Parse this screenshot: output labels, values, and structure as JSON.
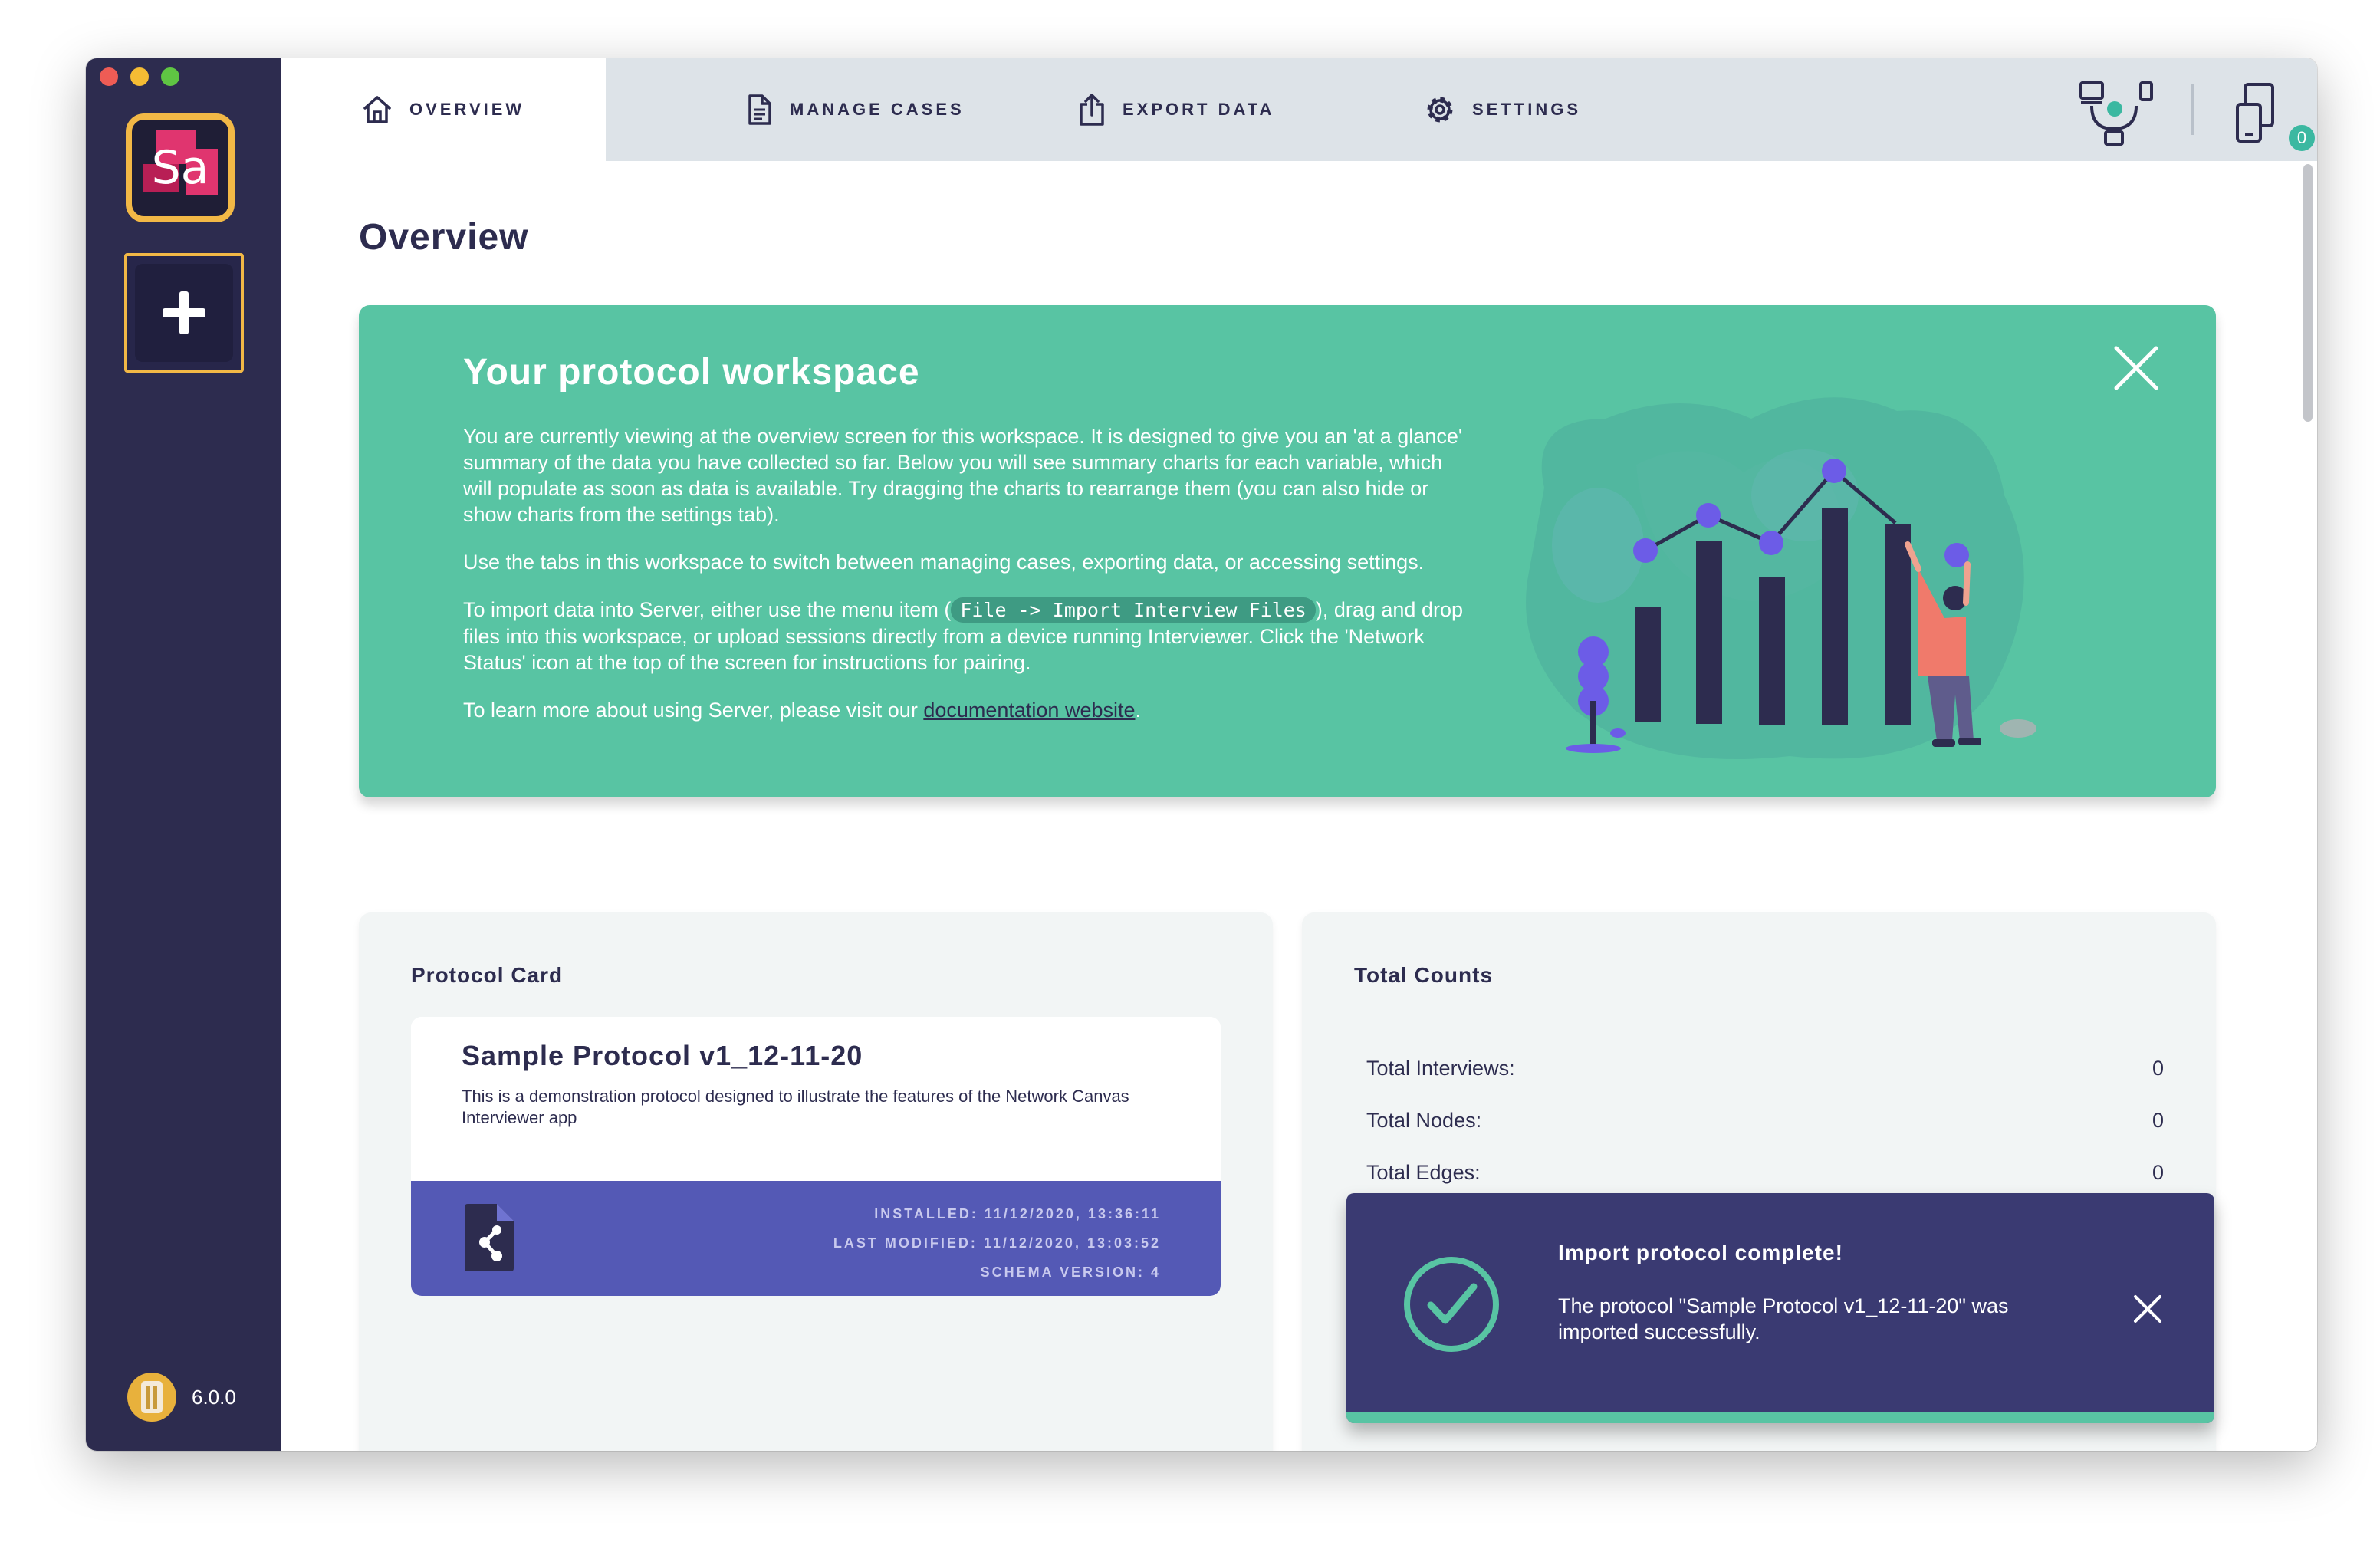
{
  "window": {
    "workspace_abbrev": "Sa",
    "version": "6.0.0"
  },
  "tabs": {
    "overview": "OVERVIEW",
    "manage_cases": "MANAGE CASES",
    "export_data": "EXPORT DATA",
    "settings": "SETTINGS"
  },
  "status": {
    "device_count": "0"
  },
  "page": {
    "title": "Overview"
  },
  "banner": {
    "title": "Your protocol workspace",
    "p1": "You are currently viewing at the overview screen for this workspace. It is designed to give you an 'at a glance' summary of the data you have collected so far. Below you will see summary charts for each variable, which will populate as soon as data is available. Try dragging the charts to rearrange them (you can also hide or show charts from the settings tab).",
    "p2": "Use the tabs in this workspace to switch between managing cases, exporting data, or accessing settings.",
    "p3_before": "To import data into Server, either use the menu item (",
    "p3_code": "File -> Import Interview Files",
    "p3_after": "), drag and drop files into this workspace, or upload sessions directly from a device running Interviewer. Click the 'Network Status' icon at the top of the screen for instructions for pairing.",
    "p4_before": "To learn more about using Server, please visit our ",
    "p4_link": "documentation website",
    "p4_after": "."
  },
  "protocol_card": {
    "heading": "Protocol Card",
    "name": "Sample Protocol v1_12-11-20",
    "description": "This is a demonstration protocol designed to illustrate the features of the Network Canvas Interviewer app",
    "installed": "INSTALLED: 11/12/2020, 13:36:11",
    "last_modified": "LAST MODIFIED: 11/12/2020, 13:03:52",
    "schema_version": "SCHEMA VERSION: 4"
  },
  "total_counts": {
    "heading": "Total Counts",
    "rows": [
      {
        "label": "Total Interviews:",
        "value": "0"
      },
      {
        "label": "Total Nodes:",
        "value": "0"
      },
      {
        "label": "Total Edges:",
        "value": "0"
      }
    ]
  },
  "toast": {
    "title": "Import protocol complete!",
    "message": "The protocol \"Sample Protocol v1_12-11-20\" was imported successfully."
  },
  "colors": {
    "sidebar": "#2d2c4f",
    "accent_yellow": "#f2b846",
    "banner_green": "#58c4a3",
    "protocol_purple": "#5459b5",
    "toast_bg": "#3a3a72"
  }
}
